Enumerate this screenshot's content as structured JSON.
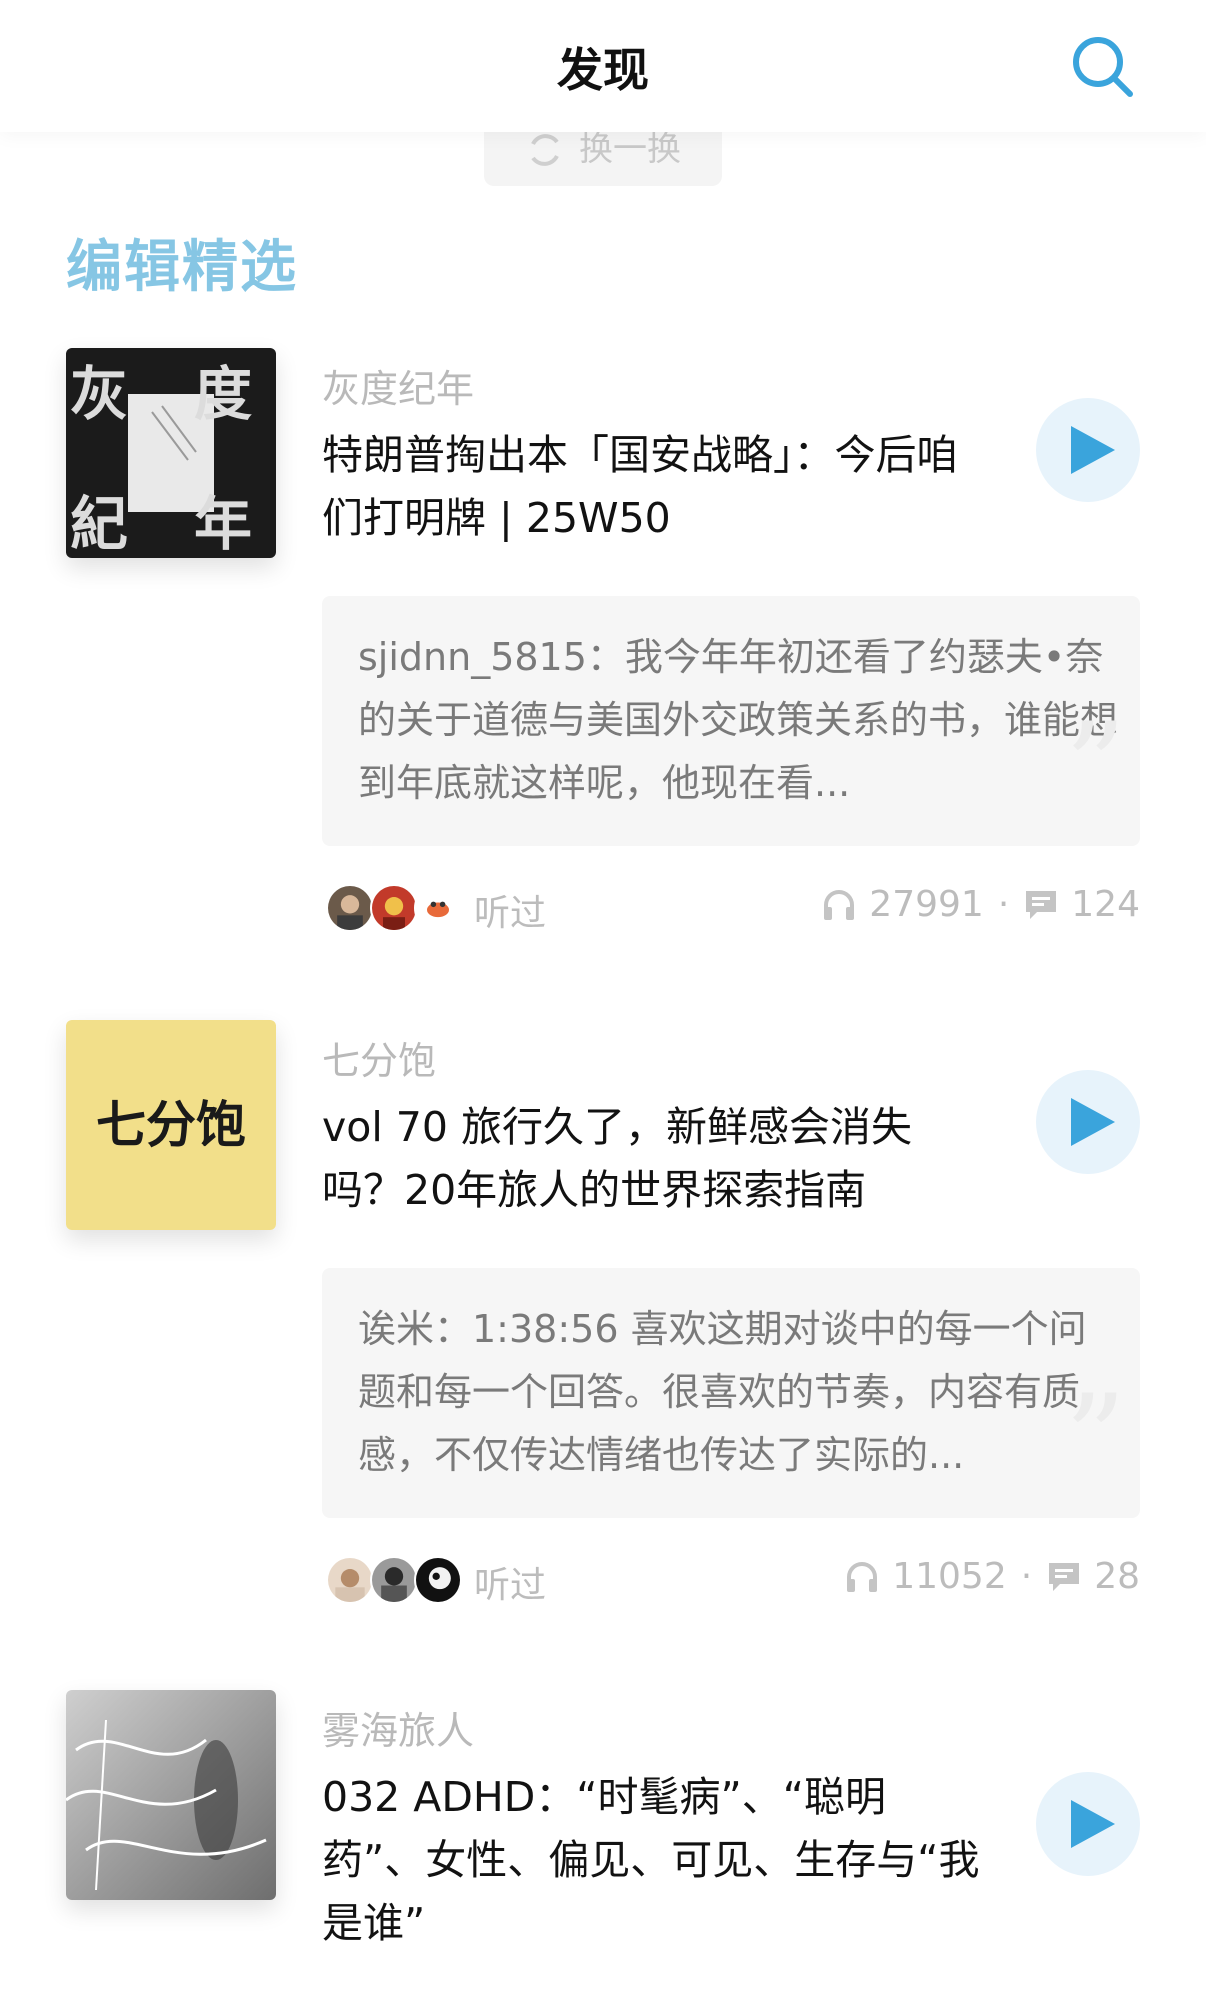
{
  "nav": {
    "title": "发现",
    "search_icon": "search-icon"
  },
  "refresh": {
    "label": "换一换",
    "icon": "refresh-icon"
  },
  "section": {
    "title": "编辑精选"
  },
  "colors": {
    "accent": "#86c6e4",
    "play_bg": "#e7f3fb",
    "play_icon": "#3aa4dc"
  },
  "episodes": [
    {
      "podcast": "灰度纪年",
      "title": "特朗普掏出本「国安战略」：今后咱们打明牌 | 25W50",
      "comment": "sjidnn_5815：我今年年初还看了约瑟夫•奈的关于道德与美国外交政策关系的书，谁能想到年底就这样呢，他现在看...",
      "heard_label": "听过",
      "plays": "27991",
      "comments": "124"
    },
    {
      "podcast": "七分饱",
      "cover_text": "七分饱",
      "title": "vol 70 旅行久了，新鲜感会消失吗？20年旅人的世界探索指南",
      "comment": "诶米：1:38:56 喜欢这期对谈中的每一个问题和每一个回答。很喜欢的节奏，内容有质感，不仅传达情绪也传达了实际的...",
      "heard_label": "听过",
      "plays": "11052",
      "comments": "28"
    },
    {
      "podcast": "雾海旅人",
      "title": "032 ADHD：“时髦病”、“聪明药”、女性、偏见、可见、生存与“我是谁”"
    }
  ]
}
